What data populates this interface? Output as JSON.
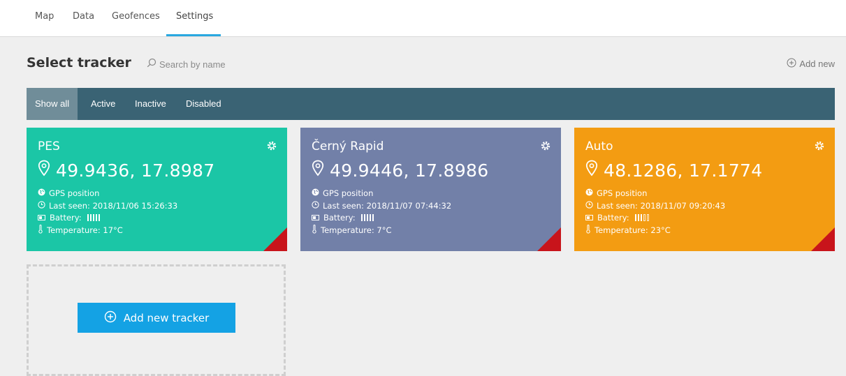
{
  "nav": {
    "tabs": [
      {
        "label": "Map"
      },
      {
        "label": "Data"
      },
      {
        "label": "Geofences"
      },
      {
        "label": "Settings",
        "active": true
      }
    ]
  },
  "header": {
    "title": "Select tracker",
    "search_placeholder": "Search by name",
    "add_new_label": "Add new"
  },
  "filters": {
    "items": [
      "Show all",
      "Active",
      "Inactive",
      "Disabled"
    ],
    "active": "Show all"
  },
  "trackers": [
    {
      "name": "PES",
      "coords": "49.9436, 17.8987",
      "source": "GPS position",
      "last_seen": "Last seen: 2018/11/06 15:26:33",
      "battery_label": "Battery:",
      "battery_level": 5,
      "temperature": "Temperature: 17°C",
      "color": "#1bc6a6"
    },
    {
      "name": "Černý Rapid",
      "coords": "49.9446, 17.8986",
      "source": "GPS position",
      "last_seen": "Last seen: 2018/11/07 07:44:32",
      "battery_label": "Battery:",
      "battery_level": 5,
      "temperature": "Temperature: 7°C",
      "color": "#7280a8"
    },
    {
      "name": "Auto",
      "coords": "48.1286, 17.1774",
      "source": "GPS position",
      "last_seen": "Last seen: 2018/11/07 09:20:43",
      "battery_label": "Battery:",
      "battery_level": 3,
      "temperature": "Temperature: 23°C",
      "color": "#f39c12"
    }
  ],
  "add_tracker": {
    "label": "Add new tracker"
  },
  "colors": {
    "accent": "#29a8e0",
    "filter_bar": "#3a6374",
    "filter_active": "#708d99",
    "corner_flag": "#c8141b",
    "add_button": "#14a2e4"
  },
  "icons": {
    "search": "search-icon",
    "add": "plus-circle-icon",
    "gear": "gear-icon",
    "pin": "map-pin-icon",
    "globe": "globe-icon",
    "clock": "clock-icon",
    "battery": "battery-icon",
    "thermometer": "thermometer-icon"
  }
}
